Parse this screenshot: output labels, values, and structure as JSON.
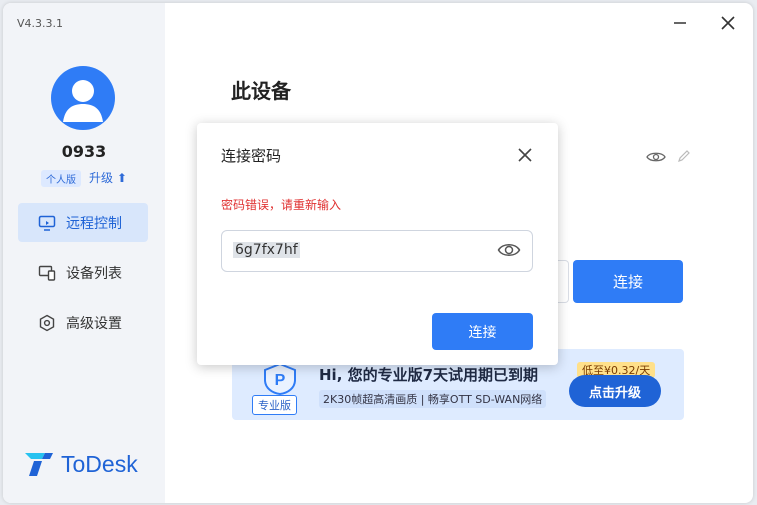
{
  "app": {
    "version": "V4.3.3.1",
    "username": "0933",
    "badge": "个人版",
    "upgrade": "升级",
    "logo_text": "ToDesk"
  },
  "nav": [
    {
      "label": "远程控制",
      "icon": "monitor-icon",
      "active": true
    },
    {
      "label": "设备列表",
      "icon": "devices-icon",
      "active": false
    },
    {
      "label": "高级设置",
      "icon": "settings-icon",
      "active": false
    }
  ],
  "main": {
    "title": "此设备",
    "connect_label": "连接"
  },
  "banner": {
    "tag": "专业版",
    "headline": "Hi, 您的专业版7天试用期已到期",
    "sub": "2K30帧超高清画质 | 畅享OTT SD-WAN网络",
    "price": "低至¥0.32/天",
    "button": "点击升级"
  },
  "dialog": {
    "title": "连接密码",
    "error": "密码错误，请重新输入",
    "password_value": "6g7fx7hf",
    "connect_label": "连接"
  },
  "colors": {
    "accent": "#2f7cf6",
    "error": "#e03131"
  }
}
